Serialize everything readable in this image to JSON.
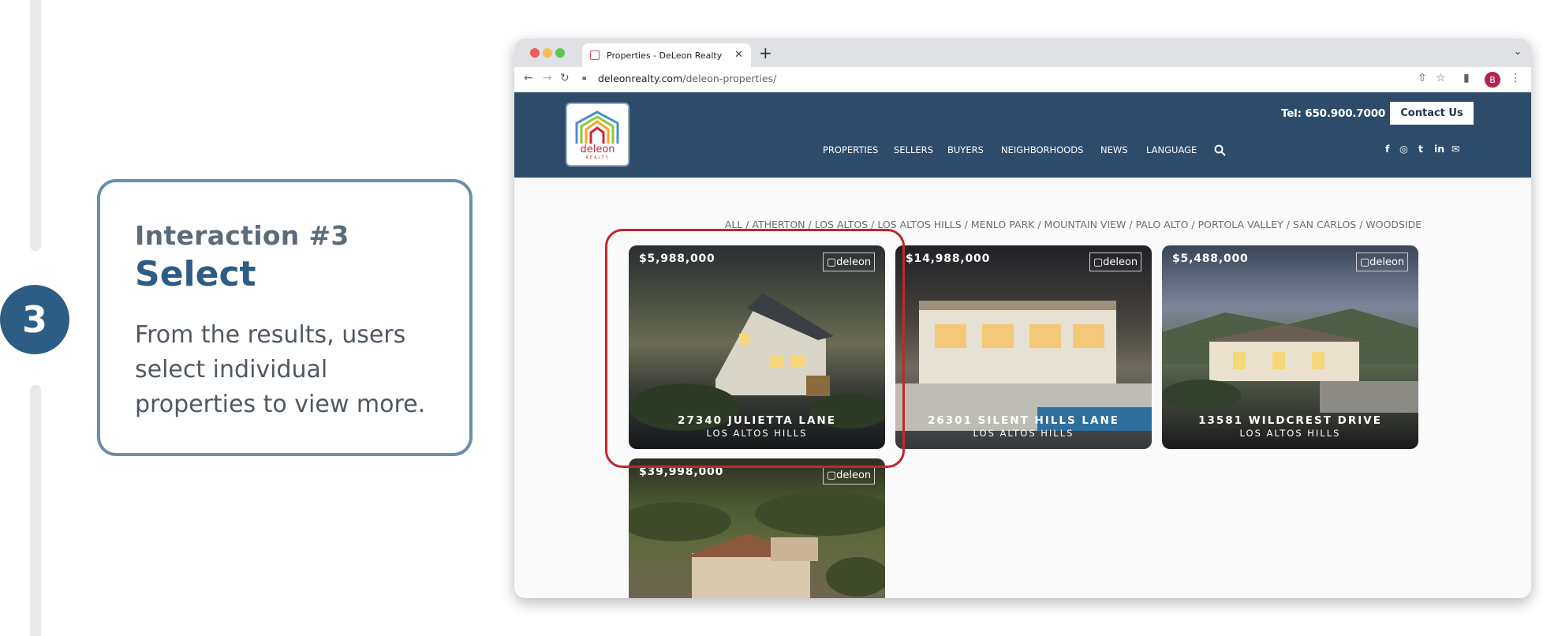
{
  "step": {
    "number": "3"
  },
  "card": {
    "kicker": "Interaction #3",
    "title": "Select",
    "description": "From the results, users select individual properties to view more."
  },
  "browser": {
    "tab_title": "Properties - DeLeon Realty",
    "new_tab": "+",
    "tab_menu": "⌄",
    "url_domain": "deleonrealty.com",
    "url_path": "/deleon-properties/",
    "profile_initial": "B",
    "icons": [
      "back-icon",
      "forward-icon",
      "reload-icon",
      "lock-icon",
      "share-icon",
      "star-icon",
      "sidepanel-icon",
      "menu-icon"
    ]
  },
  "site": {
    "logo_word": "deleon",
    "logo_sub": "REALTY",
    "tel": "Tel: 650.900.7000",
    "contact_label": "Contact Us",
    "nav": [
      "PROPERTIES",
      "SELLERS",
      "BUYERS",
      "NEIGHBORHOODS",
      "NEWS",
      "LANGUAGE"
    ],
    "social": [
      "facebook-icon",
      "instagram-icon",
      "twitter-icon",
      "linkedin-icon",
      "wechat-icon"
    ],
    "social_glyphs": [
      "f",
      "◎",
      "t",
      "in",
      "✉"
    ],
    "filter": "ALL / ATHERTON / LOS ALTOS / LOS ALTOS HILLS / MENLO PARK / MOUNTAIN VIEW / PALO ALTO / PORTOLA VALLEY / SAN CARLOS / WOODSIDE"
  },
  "listings": [
    {
      "price": "$5,988,000",
      "badge": "▢deleon",
      "address": "27340 JULIETTA LANE",
      "city": "LOS ALTOS HILLS"
    },
    {
      "price": "$14,988,000",
      "badge": "▢deleon",
      "address": "26301 SILENT HILLS LANE",
      "city": "LOS ALTOS HILLS"
    },
    {
      "price": "$5,488,000",
      "badge": "▢deleon",
      "address": "13581 WILDCREST DRIVE",
      "city": "LOS ALTOS HILLS"
    },
    {
      "price": "$39,998,000",
      "badge": "▢deleon",
      "address": "",
      "city": ""
    }
  ],
  "colors": {
    "brand_navy": "#2d4c6c",
    "accent_blue": "#2d5d84",
    "highlight_red": "#c1272d",
    "logo_red": "#c8283a"
  }
}
